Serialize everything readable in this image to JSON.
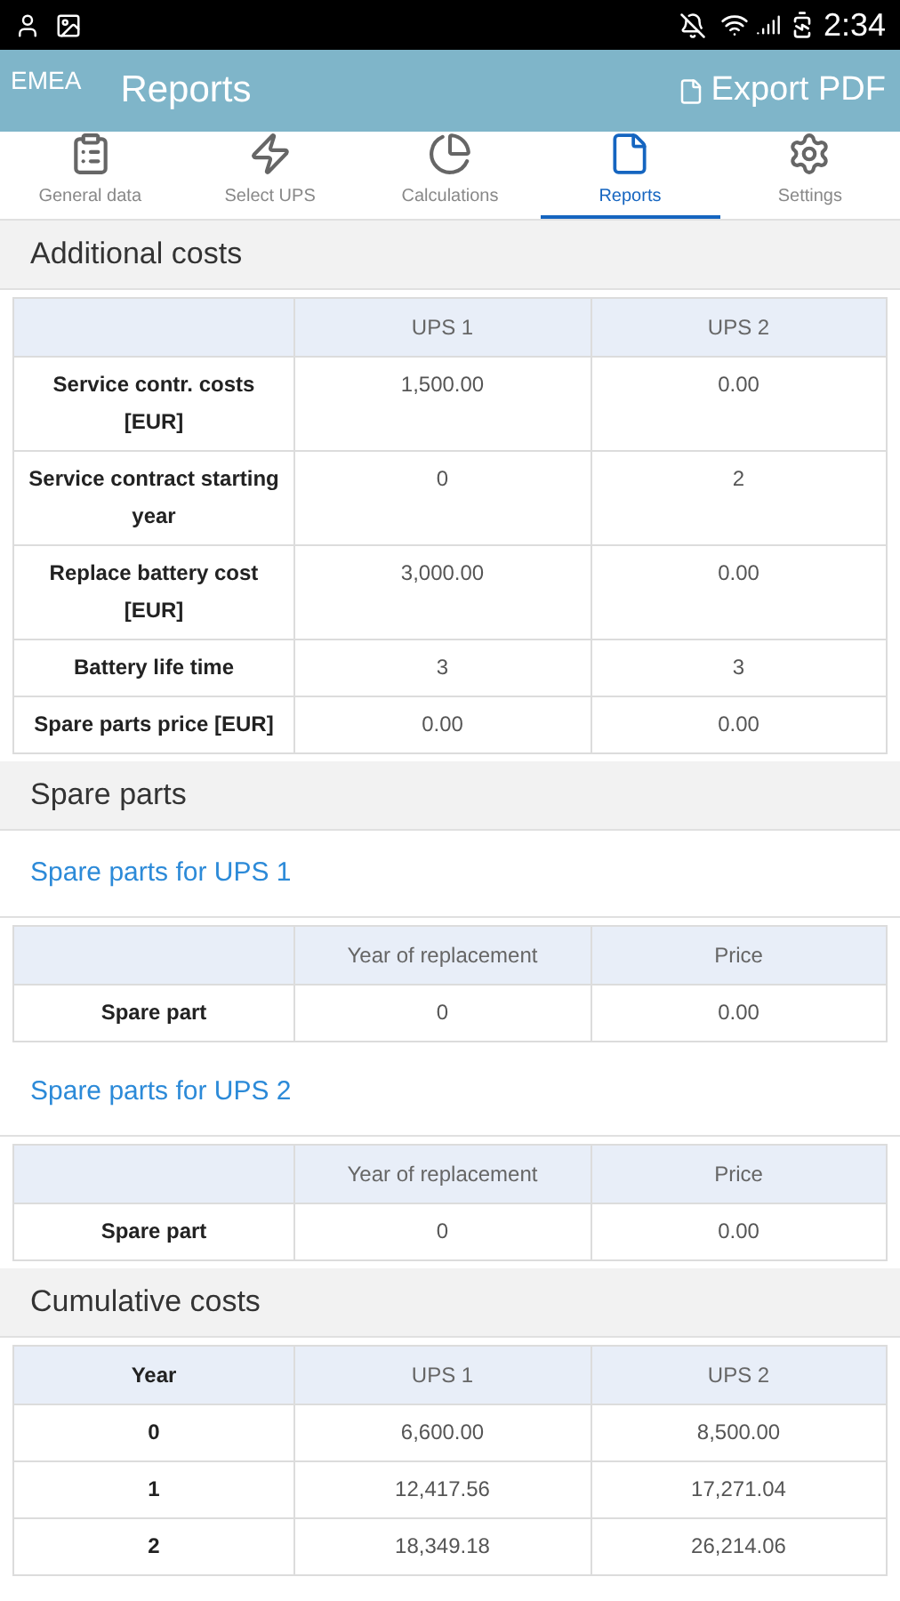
{
  "status_bar": {
    "time": "2:34"
  },
  "app_bar": {
    "brand": "EMEA",
    "title": "Reports",
    "action": "Export PDF"
  },
  "tabs": [
    {
      "label": "General data",
      "selected": false
    },
    {
      "label": "Select UPS",
      "selected": false
    },
    {
      "label": "Calculations",
      "selected": false
    },
    {
      "label": "Reports",
      "selected": true
    },
    {
      "label": "Settings",
      "selected": false
    }
  ],
  "blocks": [
    {
      "kind": "header",
      "text": "Additional costs"
    },
    {
      "kind": "table",
      "columns": [
        "UPS 1",
        "UPS 2"
      ],
      "rows": [
        {
          "label": "Service contr. costs [EUR]",
          "cells": [
            "1,500.00",
            "0.00"
          ]
        },
        {
          "label": "Service contract starting year",
          "cells": [
            "0",
            "2"
          ]
        },
        {
          "label": "Replace battery cost [EUR]",
          "cells": [
            "3,000.00",
            "0.00"
          ]
        },
        {
          "label": "Battery life time",
          "cells": [
            "3",
            "3"
          ]
        },
        {
          "label": "Spare parts price [EUR]",
          "cells": [
            "0.00",
            "0.00"
          ]
        }
      ]
    },
    {
      "kind": "header",
      "text": "Spare parts"
    },
    {
      "kind": "link",
      "text": "Spare parts for UPS 1"
    },
    {
      "kind": "table",
      "columns": [
        "Year of replacement",
        "Price"
      ],
      "rows": [
        {
          "label": "Spare part",
          "cells": [
            "0",
            "0.00"
          ]
        }
      ]
    },
    {
      "kind": "link",
      "text": "Spare parts for UPS 2"
    },
    {
      "kind": "table",
      "columns": [
        "Year of replacement",
        "Price"
      ],
      "rows": [
        {
          "label": "Spare part",
          "cells": [
            "0",
            "0.00"
          ]
        }
      ]
    },
    {
      "kind": "header",
      "text": "Cumulative costs"
    },
    {
      "kind": "table",
      "corner": "Year",
      "columns": [
        "UPS 1",
        "UPS 2"
      ],
      "rows": [
        {
          "label": "0",
          "cells": [
            "6,600.00",
            "8,500.00"
          ]
        },
        {
          "label": "1",
          "cells": [
            "12,417.56",
            "17,271.04"
          ]
        },
        {
          "label": "2",
          "cells": [
            "18,349.18",
            "26,214.06"
          ]
        }
      ]
    }
  ]
}
